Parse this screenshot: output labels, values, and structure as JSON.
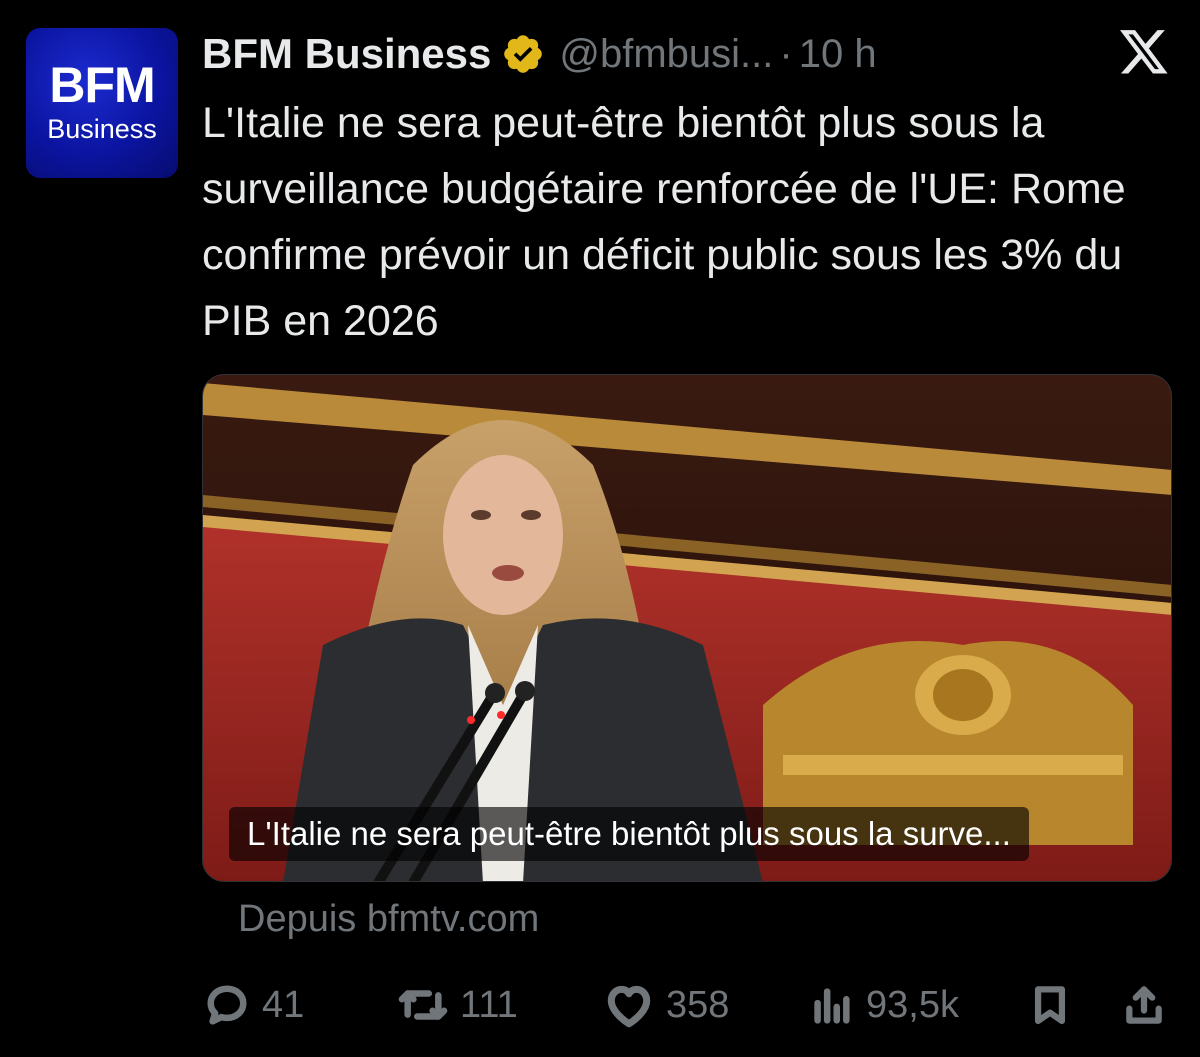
{
  "tweet": {
    "avatar": {
      "brand": "BFM",
      "sub": "Business",
      "color": "#0b14a0"
    },
    "author_name": "BFM Business",
    "verified_icon": "verified-gold-badge",
    "handle": "@bfmbusi...",
    "separator": "·",
    "time": "10 h",
    "platform_icon": "x-logo",
    "text": "L'Italie ne sera peut-être bientôt plus sous la surveillance budgétaire renforcée de l'UE: Rome confirme prévoir un déficit public sous les 3% du PIB en 2026",
    "card": {
      "title": "L'Italie ne sera peut-être bientôt plus sous la surve...",
      "source": "Depuis bfmtv.com"
    },
    "actions": {
      "replies": "41",
      "reposts": "111",
      "likes": "358",
      "views": "93,5k"
    }
  },
  "colors": {
    "background": "#000000",
    "text": "#e7e9ea",
    "muted": "#71767b",
    "verified": "#e2b719"
  }
}
